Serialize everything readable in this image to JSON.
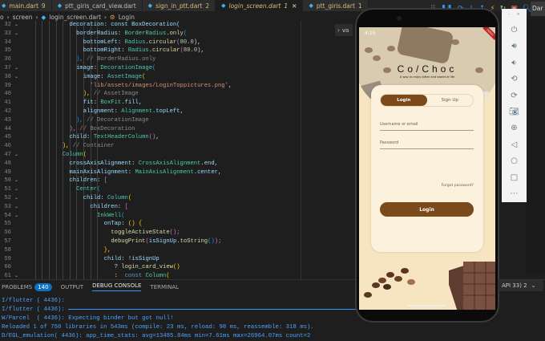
{
  "tabs": [
    {
      "label": "main.dart",
      "badge": "9"
    },
    {
      "label": "ptt_giris_card_view.dart",
      "badge": ""
    },
    {
      "label": "sign_in_ptt.dart",
      "badge": "2"
    },
    {
      "label": "login_screen.dart",
      "badge": "1",
      "active": true
    },
    {
      "label": "ptt_giris.dart",
      "badge": "1"
    }
  ],
  "breadcrumb": {
    "parts": [
      "o",
      "screen",
      "login_screen.dart",
      "Login"
    ]
  },
  "outline_button": "va",
  "code": [
    {
      "n": "32",
      "fold": true,
      "i": 14,
      "t": [
        [
          "decoration: const BoxDecoration(",
          "prop"
        ]
      ]
    },
    {
      "n": "33",
      "fold": true,
      "i": 16,
      "t": [
        [
          "borderRadius",
          "prop"
        ],
        [
          ": ",
          "p"
        ],
        [
          "BorderRadius",
          "type"
        ],
        [
          ".only",
          "fn"
        ],
        [
          "(",
          "b3"
        ]
      ]
    },
    {
      "n": "34",
      "fold": false,
      "i": 18,
      "t": [
        [
          "bottomLeft",
          "prop"
        ],
        [
          ": ",
          "p"
        ],
        [
          "Radius",
          "type"
        ],
        [
          ".circular",
          "fn"
        ],
        [
          "(",
          "b2"
        ],
        [
          "80.0",
          "num2"
        ],
        [
          "),",
          "p"
        ]
      ]
    },
    {
      "n": "35",
      "fold": false,
      "i": 18,
      "t": [
        [
          "bottomRight",
          "prop"
        ],
        [
          ": ",
          "p"
        ],
        [
          "Radius",
          "type"
        ],
        [
          ".circular",
          "fn"
        ],
        [
          "(",
          "b2"
        ],
        [
          "80.0",
          "num2"
        ],
        [
          "),",
          "p"
        ]
      ]
    },
    {
      "n": "36",
      "fold": false,
      "i": 16,
      "t": [
        [
          "),",
          "b3"
        ],
        [
          " // BorderRadius.only",
          "cm"
        ]
      ]
    },
    {
      "n": "37",
      "fold": true,
      "i": 16,
      "t": [
        [
          "image",
          "prop"
        ],
        [
          ": ",
          "p"
        ],
        [
          "DecorationImage",
          "type"
        ],
        [
          "(",
          "b3"
        ]
      ]
    },
    {
      "n": "38",
      "fold": true,
      "i": 18,
      "t": [
        [
          "image",
          "prop"
        ],
        [
          ": ",
          "p"
        ],
        [
          "AssetImage",
          "type"
        ],
        [
          "(",
          "b1"
        ]
      ]
    },
    {
      "n": "39",
      "fold": false,
      "i": 20,
      "t": [
        [
          "'lib/assets/images/LoginToppictures.png'",
          "str"
        ],
        [
          ",",
          "p"
        ]
      ]
    },
    {
      "n": "40",
      "fold": false,
      "i": 18,
      "t": [
        [
          "),",
          "b1"
        ],
        [
          " // AssetImage",
          "cm"
        ]
      ]
    },
    {
      "n": "41",
      "fold": false,
      "i": 18,
      "t": [
        [
          "fit",
          "prop"
        ],
        [
          ": ",
          "p"
        ],
        [
          "BoxFit",
          "type"
        ],
        [
          ".fill",
          "prop"
        ],
        [
          ",",
          "p"
        ]
      ]
    },
    {
      "n": "42",
      "fold": false,
      "i": 18,
      "t": [
        [
          "alignment",
          "prop"
        ],
        [
          ": ",
          "p"
        ],
        [
          "Alignment",
          "type"
        ],
        [
          ".topLeft",
          "prop"
        ],
        [
          ",",
          "p"
        ]
      ]
    },
    {
      "n": "43",
      "fold": false,
      "i": 16,
      "t": [
        [
          "),",
          "b3"
        ],
        [
          " // DecorationImage",
          "cm"
        ]
      ]
    },
    {
      "n": "44",
      "fold": false,
      "i": 14,
      "t": [
        [
          "),",
          "b2"
        ],
        [
          " // BoxDecoration",
          "cm"
        ]
      ]
    },
    {
      "n": "45",
      "fold": false,
      "i": 14,
      "t": [
        [
          "child",
          "prop"
        ],
        [
          ": ",
          "p"
        ],
        [
          "TextHeaderColumn",
          "type"
        ],
        [
          "()",
          "b2"
        ],
        [
          ",",
          "p"
        ]
      ]
    },
    {
      "n": "46",
      "fold": false,
      "i": 12,
      "t": [
        [
          "),",
          "b1"
        ],
        [
          " // Container",
          "cm"
        ]
      ]
    },
    {
      "n": "47",
      "fold": true,
      "i": 12,
      "t": [
        [
          "Column",
          "type"
        ],
        [
          "(",
          "b1"
        ]
      ]
    },
    {
      "n": "48",
      "fold": false,
      "i": 14,
      "t": [
        [
          "crossAxisAlignment",
          "prop"
        ],
        [
          ": ",
          "p"
        ],
        [
          "CrossAxisAlignment",
          "type"
        ],
        [
          ".end",
          "prop"
        ],
        [
          ",",
          "p"
        ]
      ]
    },
    {
      "n": "49",
      "fold": false,
      "i": 14,
      "t": [
        [
          "mainAxisAlignment",
          "prop"
        ],
        [
          ": ",
          "p"
        ],
        [
          "MainAxisAlignment",
          "type"
        ],
        [
          ".center",
          "prop"
        ],
        [
          ",",
          "p"
        ]
      ]
    },
    {
      "n": "50",
      "fold": true,
      "i": 14,
      "t": [
        [
          "children",
          "prop"
        ],
        [
          ": ",
          "p"
        ],
        [
          "[",
          "b2"
        ]
      ]
    },
    {
      "n": "51",
      "fold": true,
      "i": 16,
      "t": [
        [
          "Center",
          "type"
        ],
        [
          "(",
          "b3"
        ]
      ]
    },
    {
      "n": "52",
      "fold": true,
      "i": 18,
      "t": [
        [
          "child",
          "prop"
        ],
        [
          ": ",
          "p"
        ],
        [
          "Column",
          "type"
        ],
        [
          "(",
          "b1"
        ]
      ]
    },
    {
      "n": "53",
      "fold": true,
      "i": 20,
      "t": [
        [
          "children",
          "prop"
        ],
        [
          ": ",
          "p"
        ],
        [
          "[",
          "b2"
        ]
      ]
    },
    {
      "n": "54",
      "fold": true,
      "i": 22,
      "t": [
        [
          "InkWell",
          "type"
        ],
        [
          "(",
          "b3"
        ]
      ]
    },
    {
      "n": "55",
      "fold": false,
      "i": 24,
      "t": [
        [
          "onTap",
          "prop"
        ],
        [
          ": ",
          "p"
        ],
        [
          "()",
          "b1"
        ],
        [
          " {",
          "b1"
        ]
      ]
    },
    {
      "n": "56",
      "fold": false,
      "i": 26,
      "t": [
        [
          "toggleActiveState",
          "fn"
        ],
        [
          "();",
          "b2"
        ]
      ]
    },
    {
      "n": "57",
      "fold": false,
      "i": 26,
      "t": [
        [
          "debugPrint",
          "fn"
        ],
        [
          "(",
          "b2"
        ],
        [
          "isSignUp",
          "prop"
        ],
        [
          ".toString",
          "fn"
        ],
        [
          "()",
          "b3"
        ],
        [
          ");",
          "b2"
        ]
      ]
    },
    {
      "n": "58",
      "fold": false,
      "i": 24,
      "t": [
        [
          "},",
          "b1"
        ]
      ]
    },
    {
      "n": "59",
      "fold": false,
      "i": 24,
      "t": [
        [
          "child",
          "prop"
        ],
        [
          ": !",
          "p"
        ],
        [
          "isSignUp",
          "prop"
        ]
      ]
    },
    {
      "n": "60",
      "fold": false,
      "i": 27,
      "t": [
        [
          "? ",
          "p"
        ],
        [
          "login_card_view",
          "fn"
        ],
        [
          "()",
          "b1"
        ]
      ]
    },
    {
      "n": "61",
      "fold": true,
      "i": 27,
      "t": [
        [
          ":  ",
          "p"
        ],
        [
          "const ",
          "kw"
        ],
        [
          "Column",
          "type"
        ],
        [
          "(",
          "b1"
        ]
      ]
    }
  ],
  "panel": {
    "tabs": [
      "PROBLEMS",
      "OUTPUT",
      "DEBUG CONSOLE",
      "TERMINAL"
    ],
    "problems_count": "140",
    "console": [
      "I/flutter ( 4436):",
      "I/flutter ( 4436): ",
      "W/Parcel  ( 4436): Expecting binder but got null!",
      "Reloaded 1 of 750 libraries in 543ms (compile: 23 ms, reload: 98 ms, reassemble: 318 ms).",
      "D/EGL_emulation( 4436): app_time_stats: avg=13485.84ms min=7.61ms max=26964.07ms count=2"
    ]
  },
  "debug_toolbar": {
    "theme_label": "Dar"
  },
  "device_select": "API 33) 2",
  "phone": {
    "status_time": "4:15",
    "title": "Co/Choc",
    "subtitle": "A way to enjoy bitter and sweet of life",
    "tab_login": "Login",
    "tab_signup": "Sign Up",
    "username_placeholder": "Username or email",
    "password_placeholder": "Password",
    "forgot": "Forgot password?",
    "login_button": "Login",
    "debug_banner": "DEBUG"
  },
  "colors": {
    "brand_brown": "#7b4a1b",
    "cream": "#f7e5c2",
    "console_blue": "#4aa3ff"
  },
  "emulator_controls": [
    "power-icon",
    "volume-up-icon",
    "volume-down-icon",
    "rotate-left-icon",
    "rotate-right-icon",
    "camera-icon",
    "zoom-icon",
    "back-icon",
    "home-icon",
    "overview-icon",
    "more-icon"
  ]
}
